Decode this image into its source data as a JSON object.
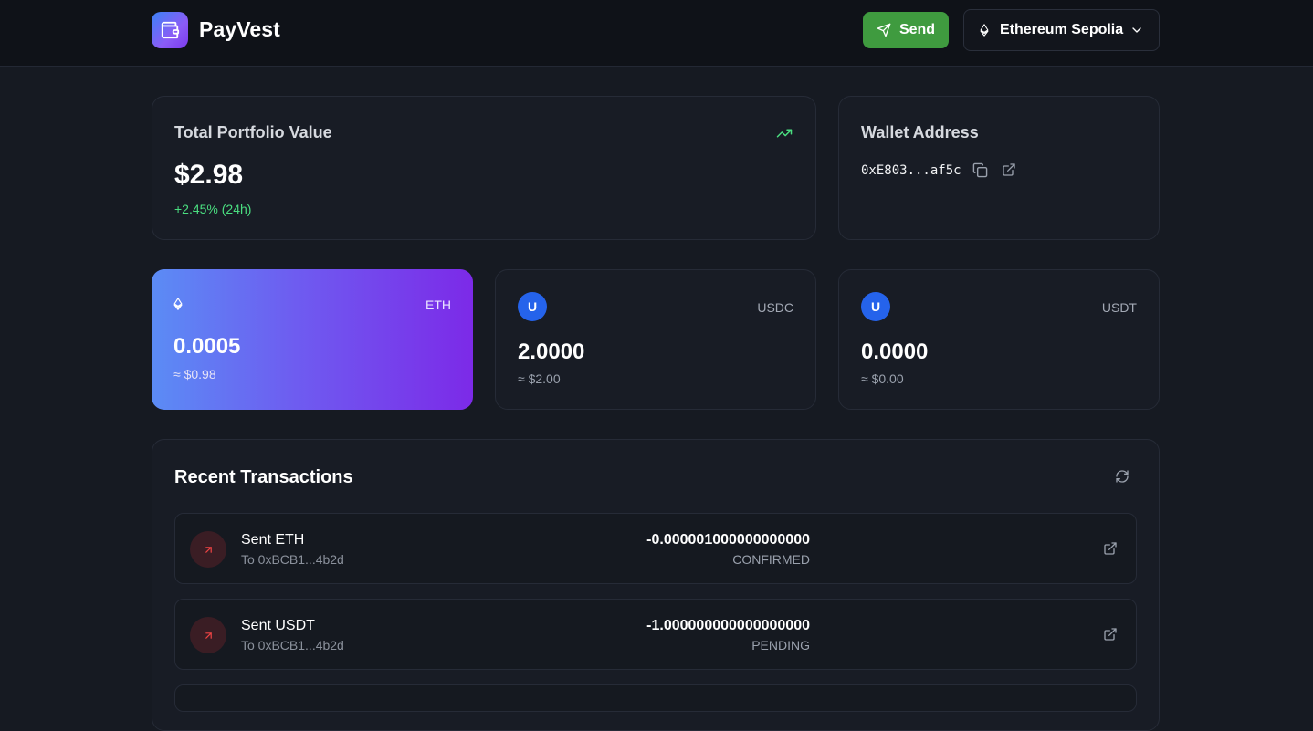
{
  "app": {
    "name": "PayVest"
  },
  "header": {
    "send_label": "Send",
    "network_label": "Ethereum Sepolia"
  },
  "portfolio": {
    "title": "Total Portfolio Value",
    "value": "$2.98",
    "change": "+2.45% (24h)"
  },
  "wallet": {
    "title": "Wallet Address",
    "address": "0xE803...af5c"
  },
  "tokens": [
    {
      "symbol": "ETH",
      "icon": "ethereum-icon",
      "amount": "0.0005",
      "fiat": "≈ $0.98"
    },
    {
      "symbol": "USDC",
      "icon_letter": "U",
      "amount": "2.0000",
      "fiat": "≈ $2.00"
    },
    {
      "symbol": "USDT",
      "icon_letter": "U",
      "amount": "0.0000",
      "fiat": "≈ $0.00"
    }
  ],
  "transactions": {
    "title": "Recent Transactions",
    "items": [
      {
        "title": "Sent ETH",
        "to": "To 0xBCB1...4b2d",
        "amount": "-0.000001000000000000",
        "status": "CONFIRMED"
      },
      {
        "title": "Sent USDT",
        "to": "To 0xBCB1...4b2d",
        "amount": "-1.000000000000000000",
        "status": "PENDING"
      }
    ]
  },
  "colors": {
    "accent_green": "#3f9b3f",
    "positive": "#4ade80",
    "token_blue": "#2563eb",
    "eth_gradient_start": "#5b8cf5",
    "eth_gradient_end": "#7c2ae8"
  }
}
